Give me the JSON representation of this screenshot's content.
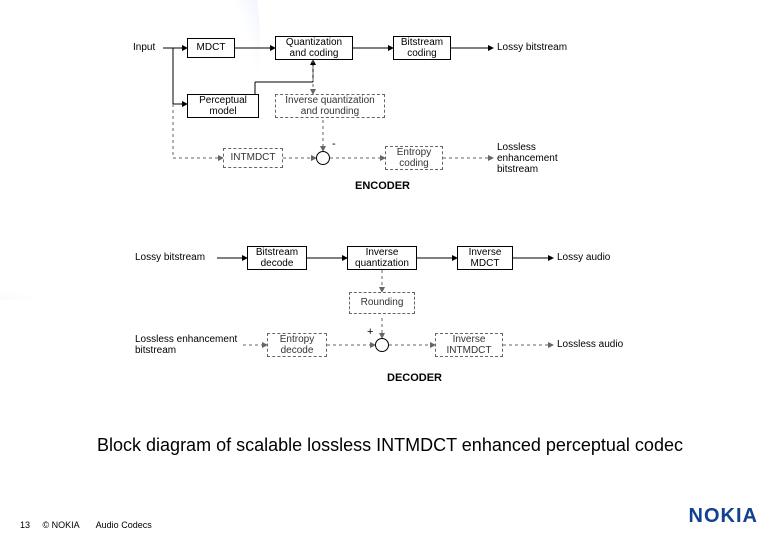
{
  "encoder": {
    "input": "Input",
    "mdct": "MDCT",
    "qc": "Quantization\nand coding",
    "bc": "Bitstream\ncoding",
    "lossy_out": "Lossy bitstream",
    "pm": "Perceptual\nmodel",
    "iqr": "Inverse quantization\nand rounding",
    "intmdct": "INTMDCT",
    "ec": "Entropy\ncoding",
    "lossless_out": "Lossless\nenhancement\nbitstream",
    "label": "ENCODER",
    "minus": "-"
  },
  "decoder": {
    "lossy_in": "Lossy bitstream",
    "bd": "Bitstream\ndecode",
    "iq": "Inverse\nquantization",
    "imdct": "Inverse\nMDCT",
    "lossy_audio": "Lossy audio",
    "rounding": "Rounding",
    "lle_in": "Lossless enhancement\nbitstream",
    "ed": "Entropy\ndecode",
    "iintmdct": "Inverse\nINTMDCT",
    "lossless_audio": "Lossless audio",
    "plus": "+",
    "label": "DECODER"
  },
  "caption": "Block diagram of scalable lossless INTMDCT enhanced perceptual codec",
  "footer": {
    "page": "13",
    "copyright": "© NOKIA",
    "title": "Audio Codecs"
  },
  "brand": "NOKIA"
}
